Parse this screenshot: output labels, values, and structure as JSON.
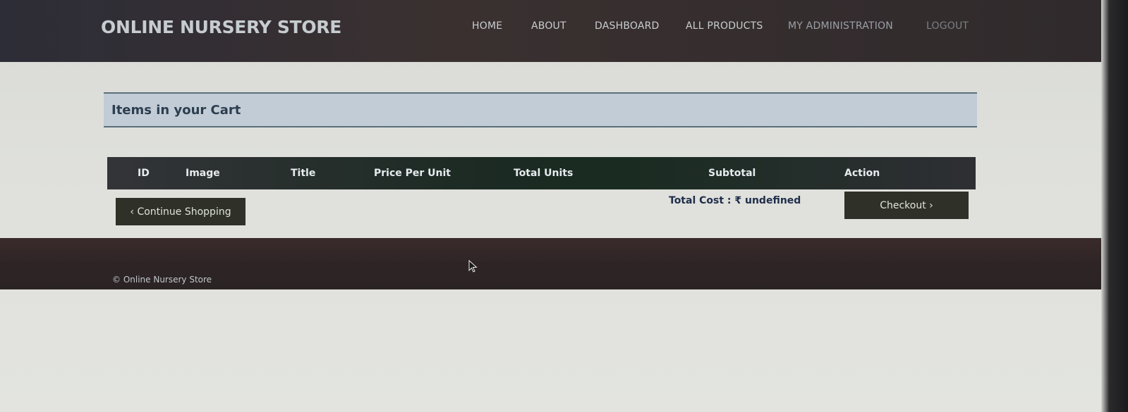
{
  "header": {
    "brand": "ONLINE NURSERY STORE",
    "nav": [
      {
        "label": "HOME"
      },
      {
        "label": "ABOUT"
      },
      {
        "label": "DASHBOARD"
      },
      {
        "label": "ALL PRODUCTS"
      },
      {
        "label": "MY ADMINISTRATION"
      },
      {
        "label": "LOGOUT"
      }
    ]
  },
  "cart": {
    "title": "Items in your Cart",
    "columns": [
      "ID",
      "Image",
      "Title",
      "Price Per Unit",
      "Total Units",
      "Subtotal",
      "Action"
    ],
    "continue_label": "‹ Continue Shopping",
    "total_cost": "Total Cost : ₹ undefined",
    "checkout_label": "Checkout ›"
  },
  "footer": {
    "copyright": "© Online Nursery Store"
  },
  "icons": {
    "cursor": "mouse-pointer-icon"
  }
}
